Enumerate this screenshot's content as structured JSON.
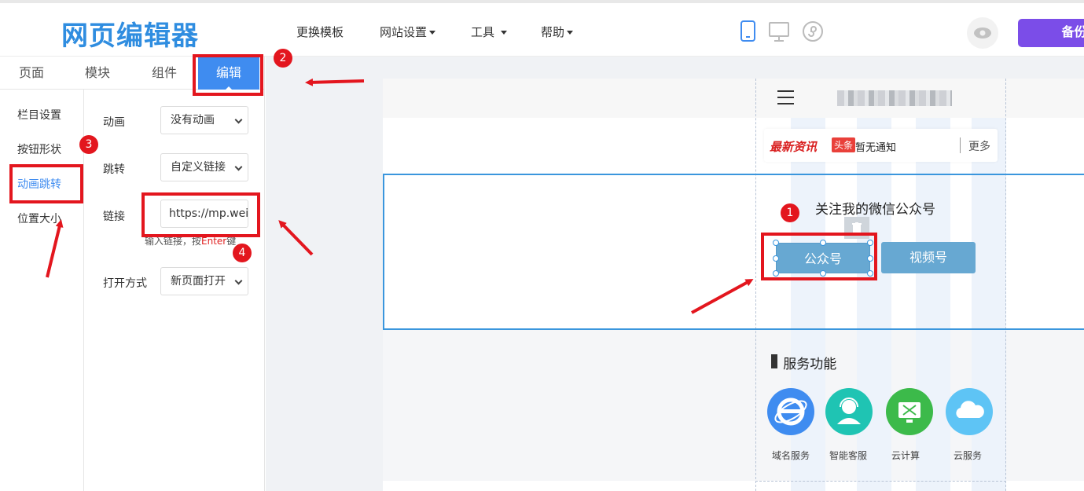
{
  "header": {
    "logo": "网页编辑器",
    "nav": [
      {
        "label": "更换模板"
      },
      {
        "label": "网站设置"
      },
      {
        "label": "工具"
      },
      {
        "label": "帮助"
      }
    ],
    "backup_label": "备份"
  },
  "left_panel": {
    "tabs": [
      {
        "label": "页面"
      },
      {
        "label": "模块"
      },
      {
        "label": "组件"
      },
      {
        "label": "编辑"
      }
    ],
    "active_tab": "编辑",
    "subnav": [
      {
        "label": "栏目设置"
      },
      {
        "label": "按钮形状"
      },
      {
        "label": "动画跳转"
      },
      {
        "label": "位置大小"
      }
    ],
    "active_subnav": "动画跳转",
    "fields": {
      "animation": {
        "label": "动画",
        "value": "没有动画"
      },
      "jump": {
        "label": "跳转",
        "value": "自定义链接"
      },
      "link": {
        "label": "链接",
        "value": "https://mp.weixin.qq.com"
      },
      "hint": {
        "prefix": "输入链接，按",
        "key": "Enter",
        "suffix": "键"
      },
      "open_mode": {
        "label": "打开方式",
        "value": "新页面打开"
      }
    }
  },
  "preview": {
    "notice": {
      "brand": "最新资讯",
      "badge": "头条",
      "text": "暂无通知",
      "more": "更多"
    },
    "wechat_section": {
      "title": "关注我的微信公众号",
      "buttons": [
        {
          "label": "公众号"
        },
        {
          "label": "视频号"
        }
      ]
    },
    "services": {
      "title": "服务功能",
      "items": [
        {
          "label": "域名服务",
          "color": "#3f8cf0",
          "icon": "ie-icon"
        },
        {
          "label": "智能客服",
          "color": "#1fc4b3",
          "icon": "support-agent-icon"
        },
        {
          "label": "云计算",
          "color": "#3cba4a",
          "icon": "cloud-computing-icon"
        },
        {
          "label": "云服务",
          "color": "#5ec4f5",
          "icon": "cloud-icon"
        }
      ]
    }
  },
  "annotations": {
    "badges": [
      "1",
      "2",
      "3",
      "4"
    ],
    "highlight_color": "#e3161e"
  }
}
